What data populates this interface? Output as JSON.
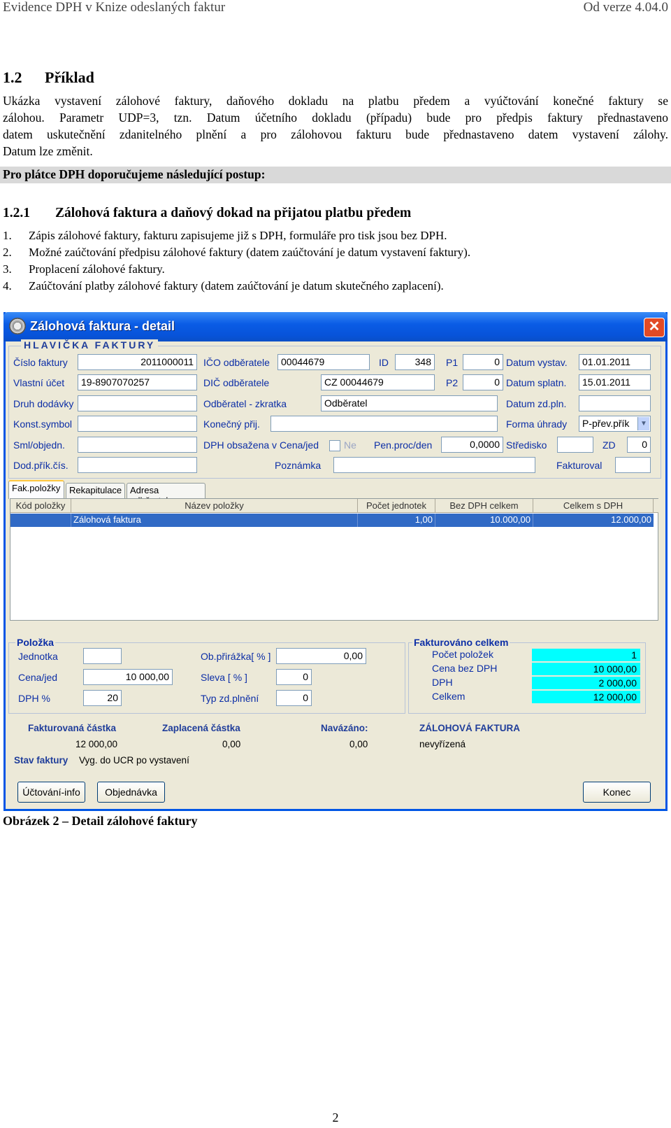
{
  "doc": {
    "header_left": "Evidence DPH v Knize odeslaných faktur",
    "header_right": "Od verze 4.04.0",
    "h2_num": "1.2",
    "h2_text": "Příklad",
    "para_lines": [
      "Ukázka vystavení zálohové faktury, daňového dokladu na platbu předem a vyúčtování konečné faktury se",
      "zálohou. Parametr UDP=3, tzn. Datum účetního dokladu (případu) bude pro předpis faktury přednastaveno",
      "datem uskutečnění zdanitelného plnění a pro zálohovou fakturu bude přednastaveno datem vystavení zálohy.",
      "Datum  lze změnit."
    ],
    "shaded": "Pro plátce DPH doporučujeme následující postup:",
    "h3_num": "1.2.1",
    "h3_text": "Zálohová faktura a daňový dokad na přijatou platbu předem",
    "steps": [
      {
        "n": "1.",
        "t": "Zápis zálohové faktury, fakturu zapisujeme již s DPH, formuláře pro tisk jsou bez DPH."
      },
      {
        "n": "2.",
        "t": "Možné zaúčtování předpisu zálohové faktury (datem zaúčtování je datum vystavení faktury)."
      },
      {
        "n": "3.",
        "t": "Proplacení zálohové faktury."
      },
      {
        "n": "4.",
        "t": "Zaúčtování platby zálohové faktury (datem zaúčtování je datum skutečného zaplacení)."
      }
    ],
    "caption": "Obrázek 2 – Detail zálohové faktury",
    "page_number": "2"
  },
  "window": {
    "title": "Zálohová faktura - detail",
    "close": "✕",
    "group_header": "HLAVIČKA FAKTURY",
    "labels": {
      "cislo_faktury": "Číslo faktury",
      "vlastni_ucet": "Vlastní účet",
      "druh_dodavky": "Druh dodávky",
      "konst_symbol": "Konst.symbol",
      "sml_objedn": "Sml/objedn.",
      "dod_prik_cis": "Dod.přík.čís.",
      "ico_odberatele": "IČO odběratele",
      "dic_odberatele": "DIČ odběratele",
      "odberatel_zkratka": "Odběratel - zkratka",
      "konecny_prij": "Konečný přij.",
      "dph_obsazena": "DPH obsažena v Cena/jed",
      "poznamka": "Poznámka",
      "id": "ID",
      "p1": "P1",
      "p2": "P2",
      "pen_proc_den": "Pen.proc/den",
      "datum_vystav": "Datum vystav.",
      "datum_splatn": "Datum splatn.",
      "datum_zd_pln": "Datum zd.pln.",
      "forma_uhrady": "Forma úhrady",
      "stredisko": "Středisko",
      "zd": "ZD",
      "fakturoval": "Fakturoval"
    },
    "values": {
      "cislo_faktury": "2011000011",
      "vlastni_ucet": "19-8907070257",
      "ico_odberatele": "00044679",
      "dic_odberatele": "CZ 00044679",
      "odberatel_zkratka": "Odběratel",
      "dph_obsazena": "Ne",
      "id": "348",
      "p1": "0",
      "p2": "0",
      "pen_proc_den": "0,0000",
      "datum_vystav": "01.01.2011",
      "datum_splatn": "15.01.2011",
      "forma_uhrady": "P-přev.přík",
      "zd": "0"
    },
    "tabs": [
      "Fak.položky",
      "Rekapitulace",
      "Adresa odběratele"
    ],
    "grid": {
      "columns": [
        "Kód položky",
        "Název položky",
        "Počet jednotek",
        "Bez DPH celkem",
        "Celkem s DPH"
      ],
      "rows": [
        [
          "",
          "Zálohová faktura",
          "1,00",
          "10.000,00",
          "12.000,00"
        ]
      ]
    },
    "polozka": {
      "title": "Položka",
      "jednotka": "Jednotka",
      "cena_jed": "Cena/jed",
      "cena_jed_val": "10 000,00",
      "dph_pct": "DPH %",
      "dph_pct_val": "20",
      "ob_prirazka": "Ob.přirážka[ % ]",
      "ob_prirazka_val": "0,00",
      "sleva": "Sleva [ % ]",
      "sleva_val": "0",
      "typ_zd": "Typ zd.plnění",
      "typ_zd_val": "0"
    },
    "fakturovano": {
      "title": "Fakturováno celkem",
      "pocet_polozek": "Počet položek",
      "pocet_polozek_val": "1",
      "cena_bez_dph": "Cena bez DPH",
      "cena_bez_dph_val": "10 000,00",
      "dph": "DPH",
      "dph_val": "2 000,00",
      "celkem": "Celkem",
      "celkem_val": "12 000,00"
    },
    "summary": {
      "fakturovana_castka": "Fakturovaná částka",
      "fakturovana_castka_val": "12 000,00",
      "zaplacena_castka": "Zaplacená částka",
      "zaplacena_castka_val": "0,00",
      "navazano": "Navázáno:",
      "navazano_val": "0,00",
      "typ": "ZÁLOHOVÁ FAKTURA",
      "typ_val": "nevyřízená",
      "stav_faktury": "Stav faktury",
      "stav_faktury_val": "Vyg. do UCR po vystavení"
    },
    "buttons": {
      "uctovani_info": "Účtování-info",
      "objednavka": "Objednávka",
      "konec": "Konec"
    }
  }
}
